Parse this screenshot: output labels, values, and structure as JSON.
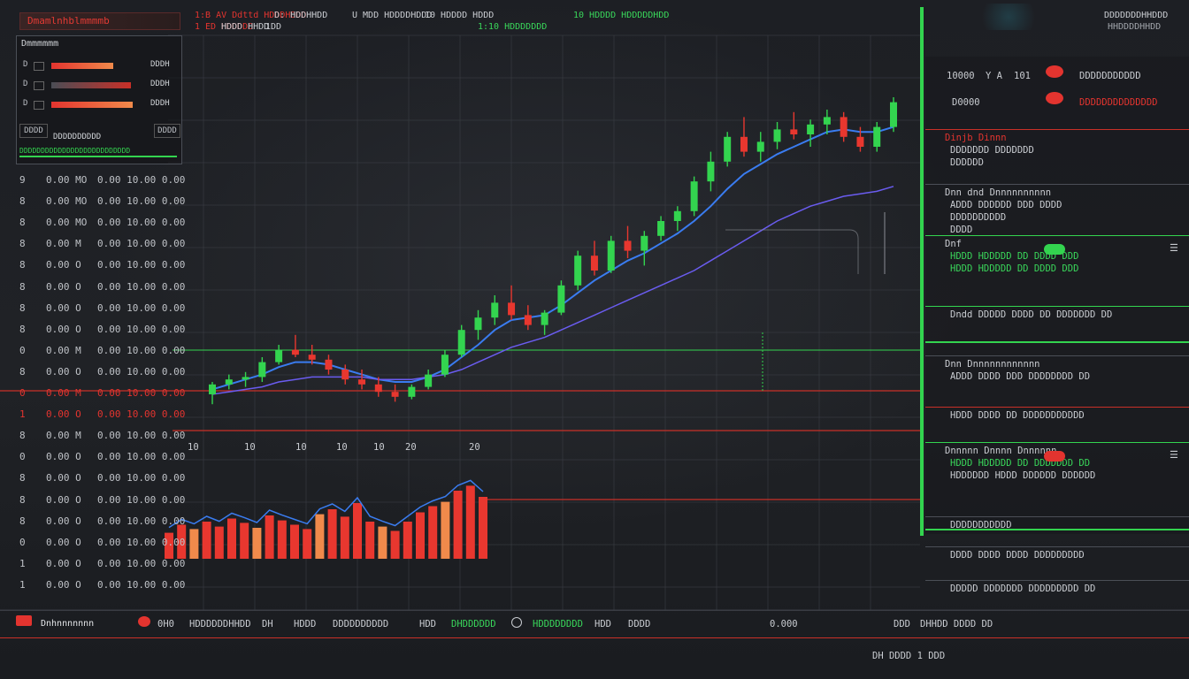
{
  "colors": {
    "up": "#33d44f",
    "down": "#e8372f",
    "ma_fast": "#3a7cf0",
    "ma_slow": "#6a5cf0",
    "accent": "#33d44f"
  },
  "header": {
    "title": "Dmamlnhblmmmmb",
    "stats": [
      {
        "label": "1:B",
        "value": "AV Ddttd HDDDHDDD",
        "color": "#e3342f"
      },
      {
        "label": "D:",
        "value": "HDDHHDD",
        "color": "#c9ccd1"
      },
      {
        "label": "",
        "value": "U MDD HDDDDHDDD",
        "color": "#c9ccd1"
      },
      {
        "label": "",
        "value": "10 HDDDD HDDD",
        "color": "#c9ccd1"
      },
      {
        "label": "",
        "value": "10 HDDDD HDDDDDHDD",
        "color": "#39d65a"
      }
    ],
    "substats": [
      "1 ED HDDDDD",
      "HDDD HHDD",
      "1DD",
      "1:10 HDDDDDDD"
    ],
    "right": [
      "DDDDDDDHHDDD",
      "HHDDDDHHDD"
    ]
  },
  "order_book": {
    "title": "Dmmmmmm",
    "rows": [
      {
        "label": "D",
        "value": "DDDH"
      },
      {
        "label": "D",
        "value": "DDDH"
      },
      {
        "label": "D",
        "value": "DDDH"
      }
    ],
    "footer_left": "DDDD",
    "footer_mid": "DDDDDDDDDD",
    "footer_right": "DDDD",
    "footer_bar": "DDDDDDDDDDDDDDDDDDDDDDDDDD"
  },
  "price_rows": [
    {
      "a": "9",
      "b": "0.00 MO",
      "c": "0.00 10.00 0.00"
    },
    {
      "a": "8",
      "b": "0.00 MO",
      "c": "0.00 10.00 0.00"
    },
    {
      "a": "8",
      "b": "0.00 MO",
      "c": "0.00 10.00 0.00"
    },
    {
      "a": "8",
      "b": "0.00 M",
      "c": "0.00 10.00 0.00"
    },
    {
      "a": "8",
      "b": "0.00 O",
      "c": "0.00 10.00 0.00"
    },
    {
      "a": "8",
      "b": "0.00 O",
      "c": "0.00 10.00 0.00"
    },
    {
      "a": "8",
      "b": "0.00 O",
      "c": "0.00 10.00 0.00"
    },
    {
      "a": "8",
      "b": "0.00 O",
      "c": "0.00 10.00 0.00"
    },
    {
      "a": "0",
      "b": "0.00 M",
      "c": "0.00 10.00 0.00"
    },
    {
      "a": "8",
      "b": "0.00 O",
      "c": "0.00 10.00 0.00"
    },
    {
      "a": "0",
      "b": "0.00 M",
      "c": "0.00 10.00 0.00"
    },
    {
      "a": "1",
      "b": "0.00 O",
      "c": "0.00 10.00 0.00"
    },
    {
      "a": "8",
      "b": "0.00 M",
      "c": "0.00 10.00 0.00"
    },
    {
      "a": "0",
      "b": "0.00 O",
      "c": "0.00 10.00 0.00"
    },
    {
      "a": "8",
      "b": "0.00 O",
      "c": "0.00 10.00 0.00"
    },
    {
      "a": "8",
      "b": "0.00 O",
      "c": "0.00 10.00 0.00"
    },
    {
      "a": "8",
      "b": "0.00 O",
      "c": "0.00 10.00 0.00"
    },
    {
      "a": "0",
      "b": "0.00 O",
      "c": "0.00 10.00 0.00"
    },
    {
      "a": "1",
      "b": "0.00 O",
      "c": "0.00 10.00 0.00"
    },
    {
      "a": "1",
      "b": "0.00 O",
      "c": "0.00 10.00 0.00"
    }
  ],
  "x_ticks": [
    "10",
    "10",
    "10",
    "10",
    "10",
    "20",
    "20"
  ],
  "chart_data": {
    "type": "candlestick",
    "ohlc": [
      [
        100,
        105,
        96,
        104
      ],
      [
        104,
        108,
        102,
        106
      ],
      [
        106,
        109,
        103,
        107
      ],
      [
        107,
        115,
        105,
        113
      ],
      [
        113,
        120,
        112,
        118
      ],
      [
        118,
        124,
        115,
        116
      ],
      [
        116,
        120,
        112,
        114
      ],
      [
        114,
        116,
        108,
        110
      ],
      [
        110,
        112,
        104,
        106
      ],
      [
        106,
        110,
        102,
        104
      ],
      [
        104,
        107,
        99,
        101
      ],
      [
        101,
        104,
        97,
        99
      ],
      [
        99,
        104,
        98,
        103
      ],
      [
        103,
        110,
        102,
        108
      ],
      [
        108,
        118,
        107,
        116
      ],
      [
        116,
        128,
        115,
        126
      ],
      [
        126,
        134,
        122,
        131
      ],
      [
        131,
        140,
        128,
        137
      ],
      [
        137,
        144,
        130,
        132
      ],
      [
        132,
        136,
        126,
        128
      ],
      [
        128,
        134,
        124,
        133
      ],
      [
        133,
        146,
        132,
        144
      ],
      [
        144,
        158,
        142,
        156
      ],
      [
        156,
        162,
        148,
        150
      ],
      [
        150,
        164,
        149,
        162
      ],
      [
        162,
        168,
        155,
        158
      ],
      [
        158,
        166,
        152,
        164
      ],
      [
        164,
        172,
        162,
        170
      ],
      [
        170,
        176,
        166,
        174
      ],
      [
        174,
        188,
        172,
        186
      ],
      [
        186,
        198,
        182,
        194
      ],
      [
        194,
        206,
        192,
        204
      ],
      [
        204,
        212,
        196,
        198
      ],
      [
        198,
        206,
        194,
        202
      ],
      [
        202,
        210,
        199,
        207
      ],
      [
        207,
        214,
        203,
        205
      ],
      [
        205,
        211,
        200,
        209
      ],
      [
        209,
        215,
        205,
        212
      ],
      [
        212,
        214,
        202,
        204
      ],
      [
        204,
        208,
        198,
        200
      ],
      [
        200,
        210,
        198,
        208
      ],
      [
        208,
        220,
        206,
        218
      ]
    ],
    "ma_fast": [
      102,
      104,
      106,
      108,
      111,
      113,
      113,
      112,
      110,
      108,
      106,
      105,
      105,
      107,
      110,
      115,
      120,
      126,
      130,
      131,
      132,
      136,
      141,
      146,
      150,
      154,
      157,
      161,
      165,
      170,
      176,
      183,
      189,
      193,
      197,
      200,
      203,
      206,
      207,
      206,
      206,
      208
    ],
    "ma_slow": [
      100,
      101,
      102,
      103,
      105,
      106,
      107,
      107,
      107,
      107,
      106,
      106,
      106,
      107,
      108,
      110,
      113,
      116,
      119,
      121,
      123,
      126,
      129,
      132,
      135,
      138,
      141,
      144,
      147,
      150,
      154,
      158,
      162,
      166,
      170,
      173,
      176,
      178,
      180,
      181,
      182,
      184
    ],
    "volume": [
      42,
      55,
      48,
      60,
      52,
      65,
      58,
      50,
      70,
      62,
      55,
      48,
      72,
      80,
      68,
      90,
      60,
      52,
      45,
      60,
      75,
      85,
      92,
      110,
      118,
      100
    ]
  },
  "right_panel": {
    "header": [
      {
        "a": "10000",
        "b": "Y A",
        "c": "101",
        "d": "DDDDDDDDDDD"
      },
      {
        "a": "D0000",
        "b": "",
        "c": "",
        "d": "DDDDDDDDDDDDDD"
      }
    ],
    "sections": [
      {
        "title": "Dinjb Dinnn",
        "title_color": "#e3342f",
        "rows": [
          "DDDDDDD DDDDDDD",
          "DDDDDD"
        ]
      },
      {
        "title": "Dnn dnd Dnnnnnnnnnn",
        "rows": [
          "ADDD DDDDDD DDD DDDD",
          "DDDDDDDDDD",
          "DDDD"
        ]
      },
      {
        "title": "Dnf",
        "rows": [
          "HDDD HDDDDD DD DDDD DDD",
          "HDDD HDDDDD DD DDDD DDD"
        ]
      },
      {
        "title": "",
        "rows": [
          "Dndd DDDDD DDDD DD DDDDDDD DD"
        ]
      },
      {
        "title": "Dnn Dnnnnnnnnnnnn",
        "rows": [
          "ADDD DDDD DDD DDDDDDDD DD"
        ]
      },
      {
        "title": "",
        "rows": [
          "HDDD DDDD DD DDDDDDDDDDD"
        ]
      },
      {
        "title": "Dnnnnn Dnnnn Dnnnnnn",
        "rows": [
          "HDDD HDDDDD DD DDDDDDD DD",
          "HDDDDDD HDDD DDDDDD DDDDDD"
        ]
      },
      {
        "title": "",
        "rows": [
          "DDDDDDDDDDD"
        ]
      },
      {
        "title": "",
        "rows": [
          "DDDD DDDD DDDD DDDDDDDDD"
        ]
      },
      {
        "title": "",
        "rows": [
          "DDDDD DDDDDDD DDDDDDDDD DD"
        ]
      }
    ]
  },
  "bottom_bar": {
    "label": "Dnhnnnnnnn",
    "items": [
      "0H0",
      "HDDDDDDHHDD",
      "DH",
      "HDDD",
      "DDDDDDDDDD",
      "HDD",
      "DHDDDDDD",
      "HDDDDDDDD",
      "HDD",
      "DDDD",
      "0.000",
      "DDD",
      "DHHDD DDDD DD"
    ],
    "footer": "DH  DDDD 1 DDD"
  }
}
